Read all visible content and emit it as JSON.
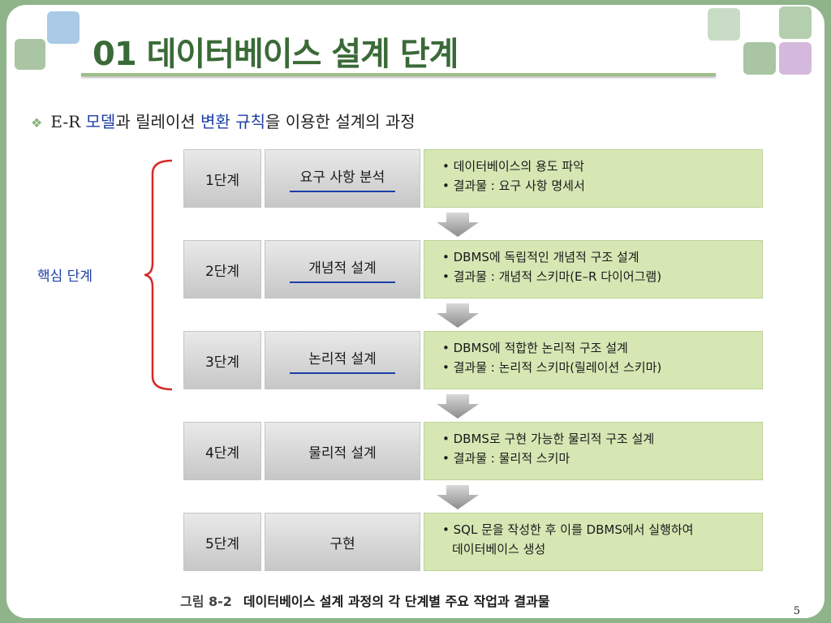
{
  "title": "01 데이터베이스 설계 단계",
  "subtitle": {
    "parts": [
      {
        "text": "E-R ",
        "link": false
      },
      {
        "text": "모델",
        "link": true
      },
      {
        "text": "과 릴레이션 ",
        "link": false
      },
      {
        "text": "변환 규칙",
        "link": true
      },
      {
        "text": "을 이용한 설계의 과정",
        "link": false
      }
    ]
  },
  "core_label": "핵심 단계",
  "stages": [
    {
      "step": "1단계",
      "name": "요구 사항 분석",
      "underline": true,
      "desc": [
        "• 데이터베이스의 용도 파악",
        "• 결과물 : 요구 사항 명세서"
      ]
    },
    {
      "step": "2단계",
      "name": "개념적 설계",
      "underline": true,
      "desc": [
        "• DBMS에 독립적인 개념적 구조 설계",
        "• 결과물 : 개념적 스키마(E–R 다이어그램)"
      ]
    },
    {
      "step": "3단계",
      "name": "논리적 설계",
      "underline": true,
      "desc": [
        "• DBMS에 적합한 논리적 구조 설계",
        "• 결과물 : 논리적 스키마(릴레이션 스키마)"
      ]
    },
    {
      "step": "4단계",
      "name": "물리적 설계",
      "underline": false,
      "desc": [
        "• DBMS로 구현 가능한 물리적 구조 설계",
        "• 결과물 : 물리적 스키마"
      ]
    },
    {
      "step": "5단계",
      "name": "구현",
      "underline": false,
      "desc": [
        "• SQL 문을 작성한 후 이를 DBMS에서 실행하여",
        "데이터베이스 생성"
      ]
    }
  ],
  "caption": {
    "fig": "그림 8-2",
    "text": "데이터베이스 설계 과정의 각 단계별 주요 작업과 결과물"
  },
  "page_number": "5",
  "colors": {
    "title": "#3a6a37",
    "link": "#1c3ea8",
    "desc_bg": "#d6e7b4",
    "bracket": "#d42a2a"
  }
}
